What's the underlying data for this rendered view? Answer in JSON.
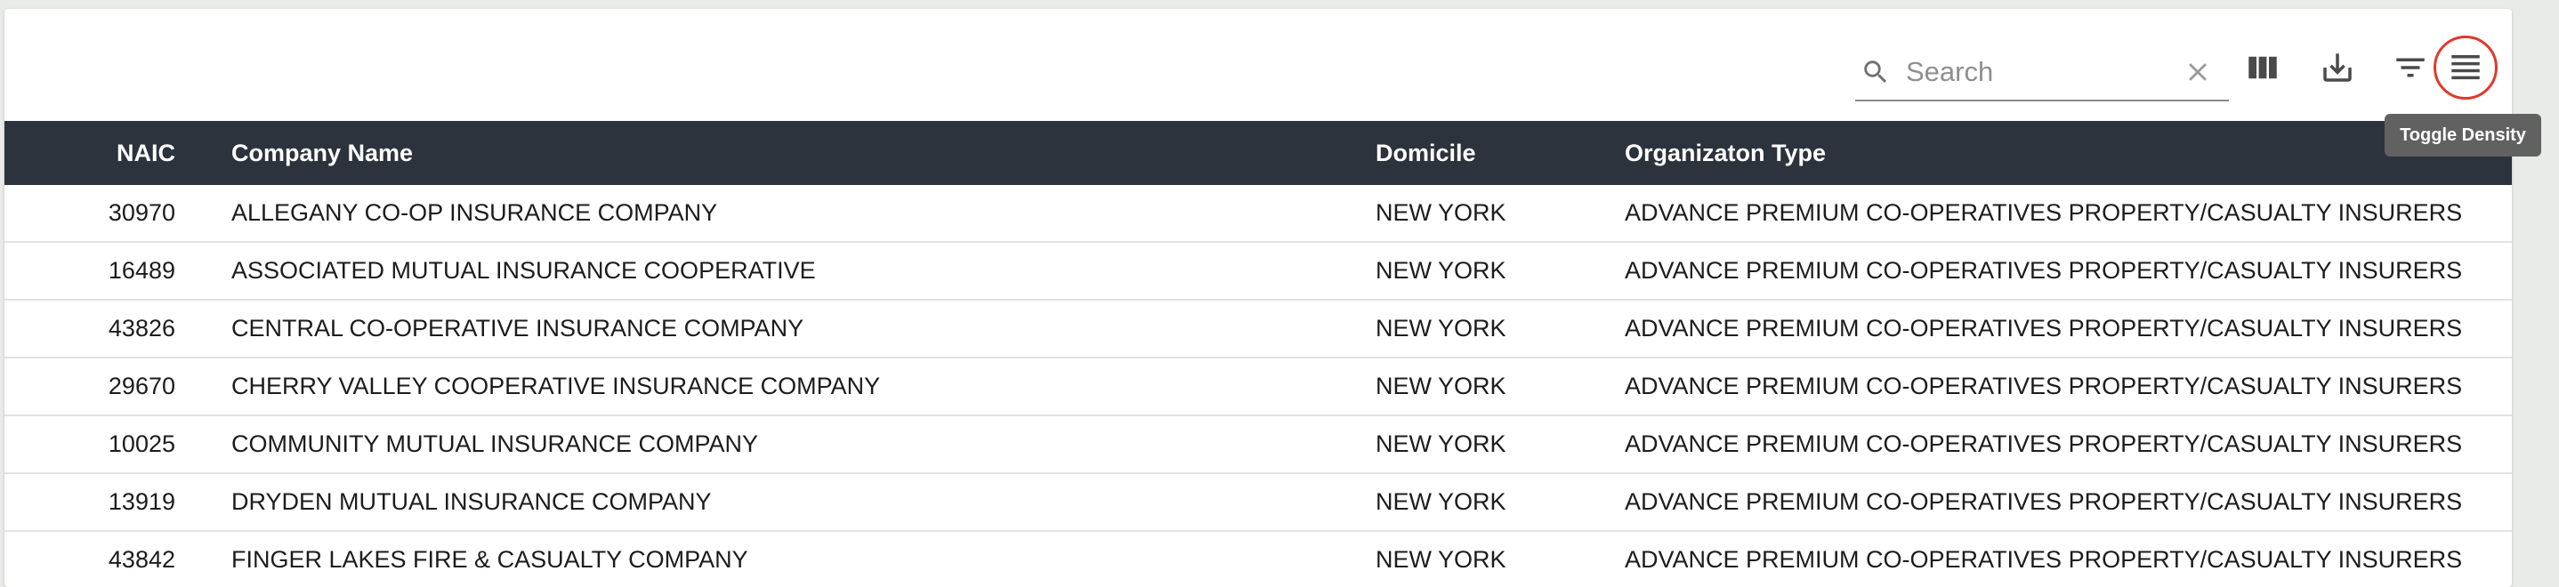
{
  "toolbar": {
    "search_placeholder": "Search",
    "icons": [
      "search-icon",
      "clear-icon",
      "view-columns-icon",
      "download-icon",
      "filter-list-icon",
      "density-icon"
    ],
    "tooltip": "Toggle Density",
    "highlight_color": "#e0392b"
  },
  "table": {
    "header_bg": "#2c333d",
    "columns": [
      "NAIC",
      "Company Name",
      "Domicile",
      "Organizaton Type"
    ],
    "rows": [
      {
        "naic": "30970",
        "name": "ALLEGANY CO-OP INSURANCE COMPANY",
        "domicile": "NEW YORK",
        "type": "ADVANCE PREMIUM CO-OPERATIVES PROPERTY/CASUALTY INSURERS"
      },
      {
        "naic": "16489",
        "name": "ASSOCIATED MUTUAL INSURANCE COOPERATIVE",
        "domicile": "NEW YORK",
        "type": "ADVANCE PREMIUM CO-OPERATIVES PROPERTY/CASUALTY INSURERS"
      },
      {
        "naic": "43826",
        "name": "CENTRAL CO-OPERATIVE INSURANCE COMPANY",
        "domicile": "NEW YORK",
        "type": "ADVANCE PREMIUM CO-OPERATIVES PROPERTY/CASUALTY INSURERS"
      },
      {
        "naic": "29670",
        "name": "CHERRY VALLEY COOPERATIVE INSURANCE COMPANY",
        "domicile": "NEW YORK",
        "type": "ADVANCE PREMIUM CO-OPERATIVES PROPERTY/CASUALTY INSURERS"
      },
      {
        "naic": "10025",
        "name": "COMMUNITY MUTUAL INSURANCE COMPANY",
        "domicile": "NEW YORK",
        "type": "ADVANCE PREMIUM CO-OPERATIVES PROPERTY/CASUALTY INSURERS"
      },
      {
        "naic": "13919",
        "name": "DRYDEN MUTUAL INSURANCE COMPANY",
        "domicile": "NEW YORK",
        "type": "ADVANCE PREMIUM CO-OPERATIVES PROPERTY/CASUALTY INSURERS"
      },
      {
        "naic": "43842",
        "name": "FINGER LAKES FIRE & CASUALTY COMPANY",
        "domicile": "NEW YORK",
        "type": "ADVANCE PREMIUM CO-OPERATIVES PROPERTY/CASUALTY INSURERS"
      }
    ]
  }
}
